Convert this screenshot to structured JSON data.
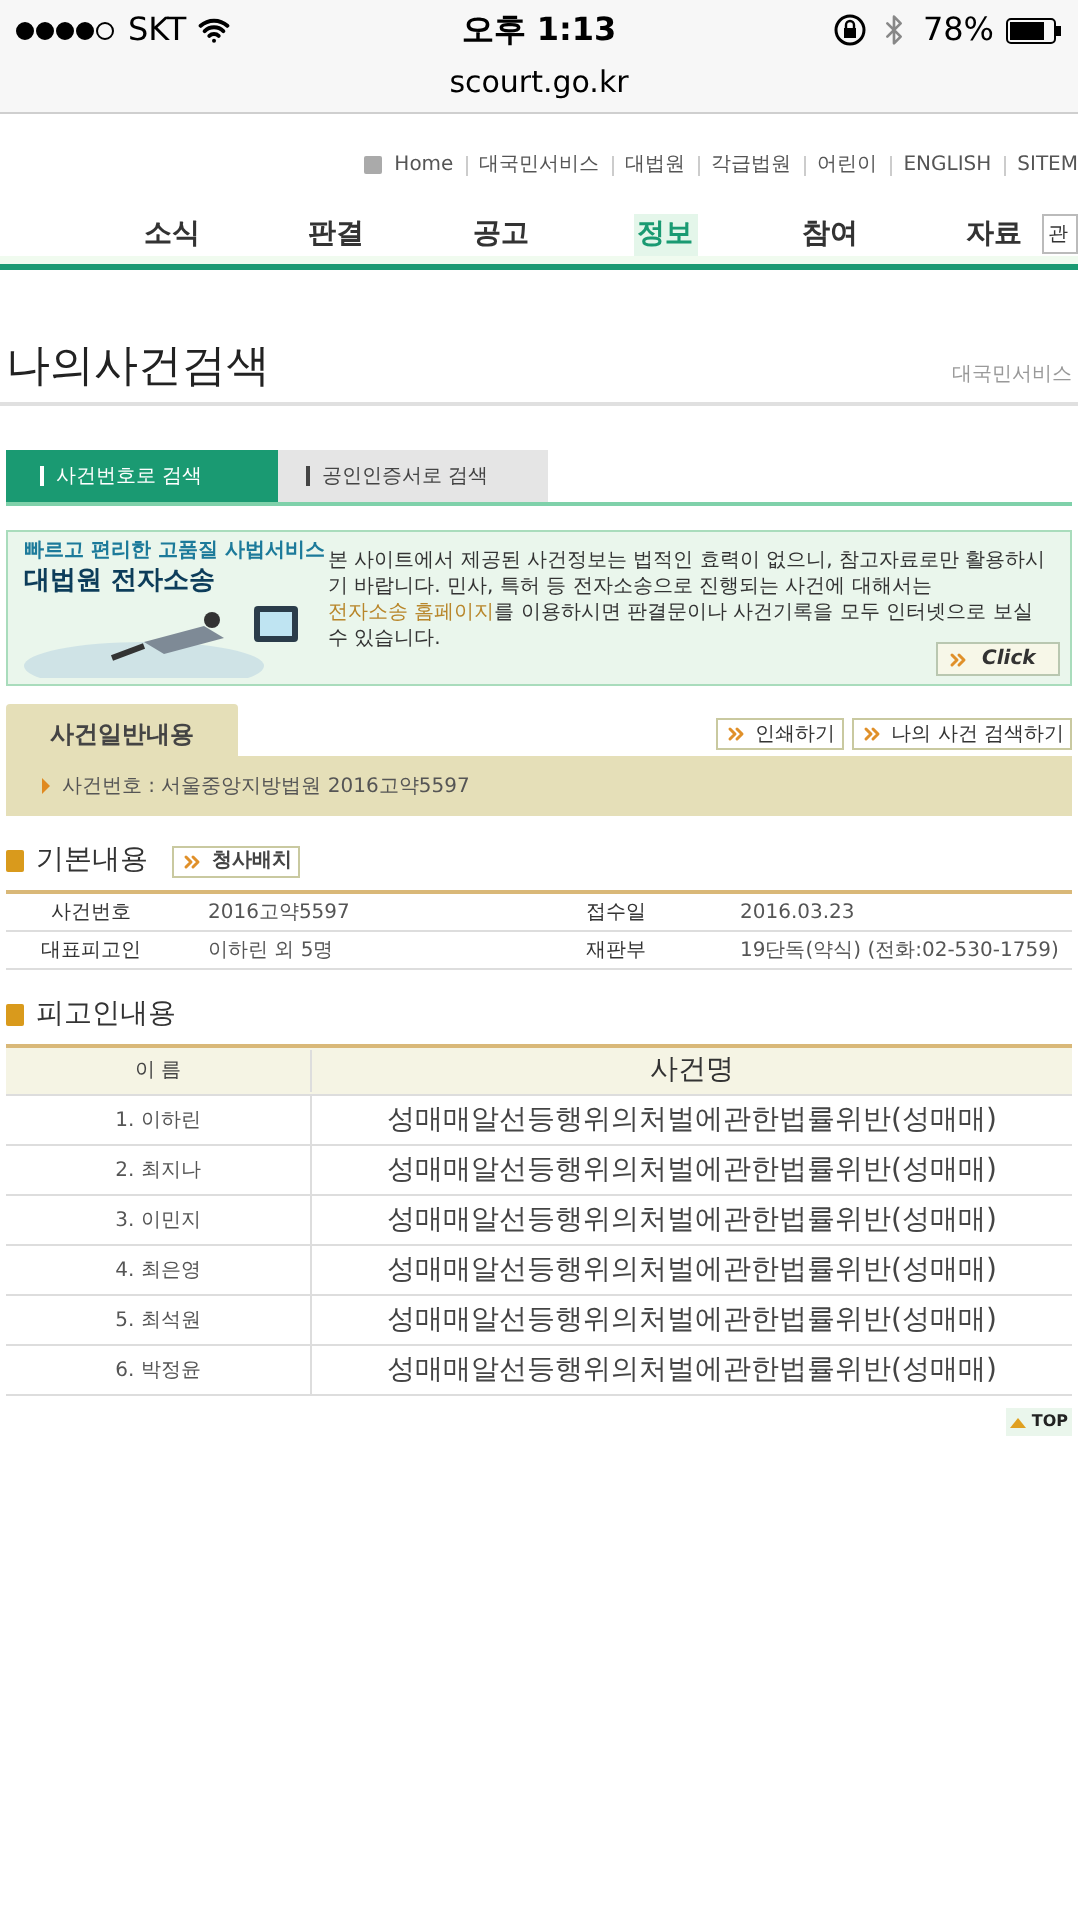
{
  "status_bar": {
    "carrier": "SKT",
    "time": "오후 1:13",
    "battery": "78%"
  },
  "browser": {
    "url": "scourt.go.kr"
  },
  "top_links": [
    "Home",
    "대국민서비스",
    "대법원",
    "각급법원",
    "어린이",
    "ENGLISH",
    "SITEM"
  ],
  "nav": [
    {
      "label": "소식",
      "selected": false
    },
    {
      "label": "판결",
      "selected": false
    },
    {
      "label": "공고",
      "selected": false
    },
    {
      "label": "정보",
      "selected": true
    },
    {
      "label": "참여",
      "selected": false
    },
    {
      "label": "자료",
      "selected": false
    }
  ],
  "search": {
    "value": "관"
  },
  "page": {
    "title": "나의사건검색",
    "breadcrumb": "대국민서비스"
  },
  "tabs": [
    {
      "label": "사건번호로 검색",
      "selected": true
    },
    {
      "label": "공인인증서로 검색",
      "selected": false
    }
  ],
  "banner": {
    "tagline": "빠르고 편리한 고품질 사법서비스",
    "title": "대법원 전자소송",
    "notice_before": "본 사이트에서 제공된 사건정보는 법적인 효력이 없으니, 참고자료로만 활용하시기 바랍니다. 민사, 특허 등 전자소송으로 진행되는 사건에 대해서는 ",
    "notice_link": "전자소송 홈페이지",
    "notice_after": "를 이용하시면 판결문이나 사건기록을 모두 인터넷으로 보실 수 있습니다.",
    "button": "Click"
  },
  "case_general": {
    "heading": "사건일반내용",
    "buttons": [
      "인쇄하기",
      "나의 사건 검색하기"
    ],
    "case_number": "사건번호 : 서울중앙지방법원 2016고약5597"
  },
  "basic_info": {
    "heading": "기본내용",
    "button": "청사배치",
    "rows": [
      {
        "label1": "사건번호",
        "value1": "2016고약5597",
        "label2": "접수일",
        "value2": "2016.03.23"
      },
      {
        "label1": "대표피고인",
        "value1": "이하린 외 5명",
        "label2": "재판부",
        "value2": "19단독(약식) (전화:02-530-1759)"
      }
    ]
  },
  "defendants": {
    "heading": "피고인내용",
    "columns": [
      "이 름",
      "사건명"
    ],
    "rows": [
      {
        "name": "1. 이하린",
        "charge": "성매매알선등행위의처벌에관한법률위반(성매매)"
      },
      {
        "name": "2. 최지나",
        "charge": "성매매알선등행위의처벌에관한법률위반(성매매)"
      },
      {
        "name": "3. 이민지",
        "charge": "성매매알선등행위의처벌에관한법률위반(성매매)"
      },
      {
        "name": "4. 최은영",
        "charge": "성매매알선등행위의처벌에관한법률위반(성매매)"
      },
      {
        "name": "5. 최석원",
        "charge": "성매매알선등행위의처벌에관한법률위반(성매매)"
      },
      {
        "name": "6. 박정윤",
        "charge": "성매매알선등행위의처벌에관한법률위반(성매매)"
      }
    ]
  },
  "top_button": "TOP"
}
